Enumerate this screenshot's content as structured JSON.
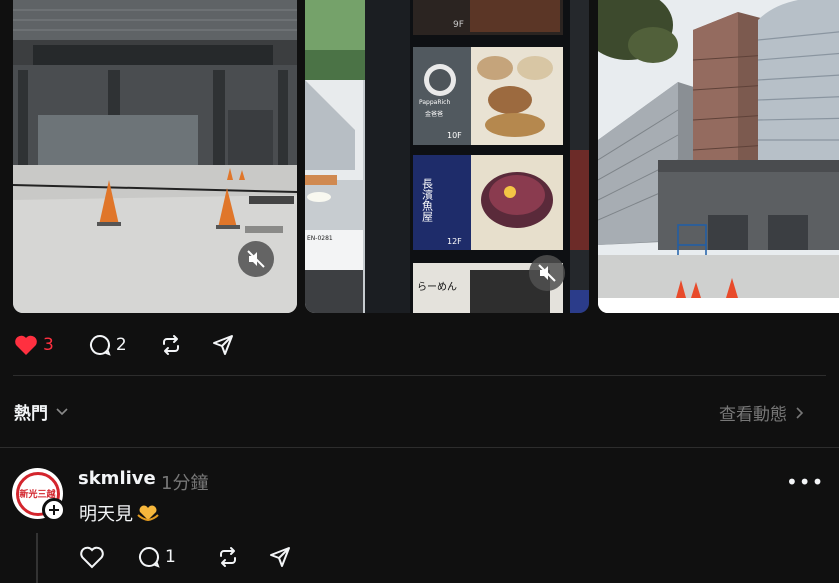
{
  "post": {
    "likes": "3",
    "comments": "2",
    "liked": true,
    "like_color": "#ff3040"
  },
  "replies_header": {
    "sort_label": "熱門",
    "view_activity": "查看動態"
  },
  "comment": {
    "username": "skmlive",
    "time": "1分鐘",
    "text": "明天見",
    "emoji": "heart-hands-emoji",
    "avatar_text": "新光三越",
    "comments": "1"
  },
  "store_directory": {
    "floor_9": "9F",
    "floor_10": "10F",
    "floor_12": "12F",
    "restaurant_10": "PappaRich",
    "restaurant_10_cn": "金爸爸",
    "restaurant_12": "長濱魚屋",
    "restaurant_lower": "らーめん"
  },
  "bus_sign": {
    "route": "EN-0281"
  }
}
